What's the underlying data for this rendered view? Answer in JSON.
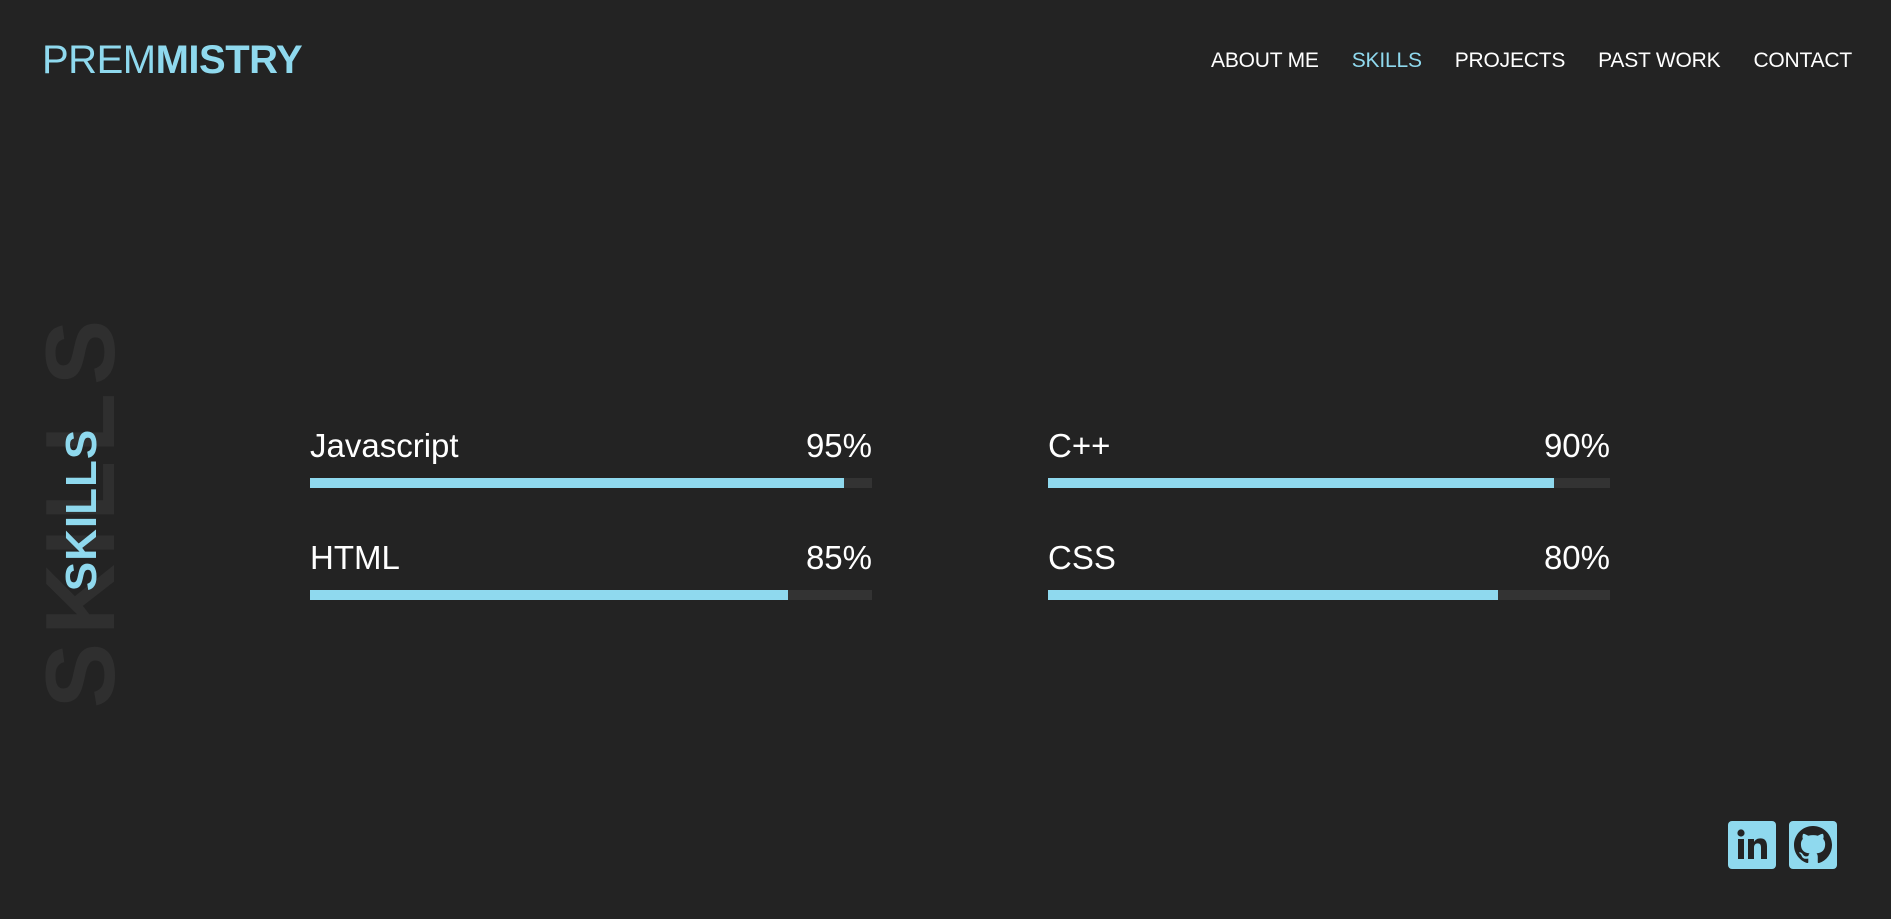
{
  "header": {
    "logo_first": "PREM",
    "logo_last": "MISTRY",
    "nav": [
      {
        "label": "ABOUT ME",
        "active": false
      },
      {
        "label": "SKILLS",
        "active": true
      },
      {
        "label": "PROJECTS",
        "active": false
      },
      {
        "label": "PAST WORK",
        "active": false
      },
      {
        "label": "CONTACT",
        "active": false
      }
    ]
  },
  "section": {
    "ghost_title": "SKILLS",
    "title": "SKILLS"
  },
  "skills": [
    {
      "name": "Javascript",
      "percent_label": "95%",
      "level": 0.95
    },
    {
      "name": "C++",
      "percent_label": "90%",
      "level": 0.9
    },
    {
      "name": "HTML",
      "percent_label": "85%",
      "level": 0.85
    },
    {
      "name": "CSS",
      "percent_label": "80%",
      "level": 0.8
    }
  ],
  "social": [
    {
      "icon": "linkedin-icon"
    },
    {
      "icon": "github-icon"
    }
  ],
  "colors": {
    "background": "#232323",
    "accent": "#8fd9ee",
    "text": "#ffffff",
    "track": "#333333",
    "ghost": "#2f2f2f"
  }
}
